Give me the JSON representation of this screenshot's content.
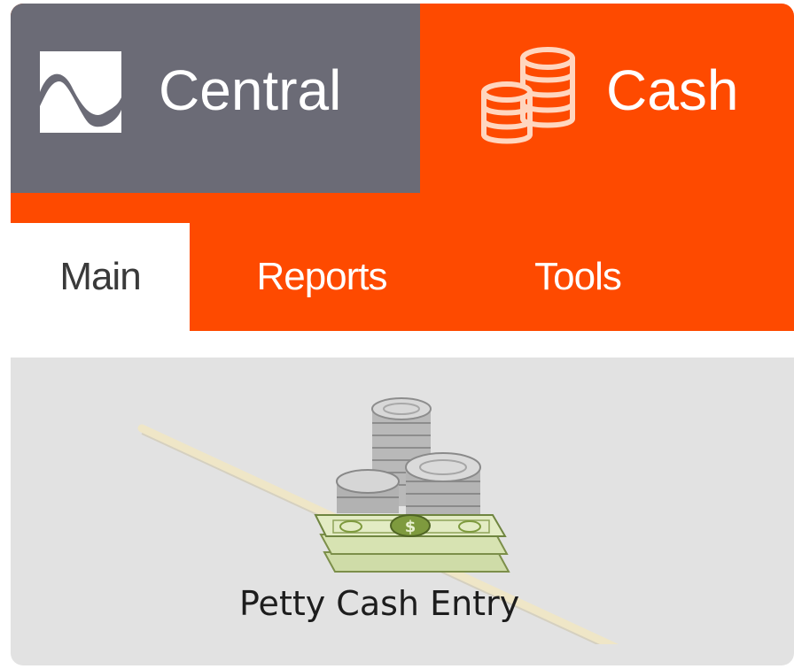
{
  "header": {
    "modules": [
      {
        "label": "Central",
        "icon": "central-wave-logo",
        "color": "#6b6b76"
      },
      {
        "label": "Cash",
        "icon": "coin-stack-icon",
        "color": "#fe4a00"
      }
    ]
  },
  "tabs": [
    {
      "label": "Main",
      "active": true
    },
    {
      "label": "Reports",
      "active": false
    },
    {
      "label": "Tools",
      "active": false
    }
  ],
  "ribbon": {
    "items": [
      {
        "label": "Petty Cash Entry",
        "icon": "petty-cash-money-icon"
      }
    ]
  },
  "colors": {
    "accent": "#fe4a00",
    "module_gray": "#6b6b76",
    "ribbon_bg": "#e2e2e2"
  }
}
